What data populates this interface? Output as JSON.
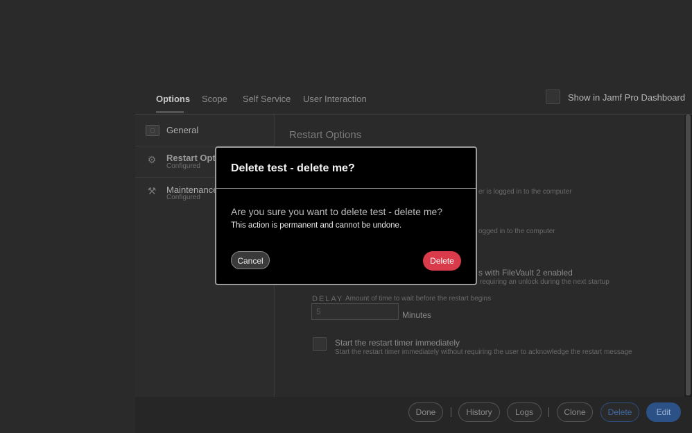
{
  "tabs": [
    {
      "label": "Options"
    },
    {
      "label": "Scope"
    },
    {
      "label": "Self Service"
    },
    {
      "label": "User Interaction"
    }
  ],
  "dashboard": {
    "label": "Show in Jamf Pro Dashboard"
  },
  "sidebar": {
    "items": [
      {
        "label": "General",
        "sub": ""
      },
      {
        "label": "Restart Opti",
        "sub": "Configured"
      },
      {
        "label": "Maintenance",
        "sub": "Configured"
      }
    ]
  },
  "main": {
    "title": "Restart Options",
    "line1": "er is logged in to the computer",
    "line2": "ogged in to the computer",
    "filevault_head": "s with FileVault 2 enabled",
    "filevault_sub": "requiring an unlock during the next startup",
    "delay_label": "DELAY",
    "delay_desc": "Amount of time to wait before the restart begins",
    "delay_value": "5",
    "minutes": "Minutes",
    "timer_head": "Start the restart timer immediately",
    "timer_sub": "Start the restart timer immediately without requiring the user to acknowledge the restart message"
  },
  "footer": {
    "done": "Done",
    "history": "History",
    "logs": "Logs",
    "clone": "Clone",
    "delete": "Delete",
    "edit": "Edit"
  },
  "modal": {
    "title": "Delete test - delete me?",
    "question": "Are you sure you want to delete test - delete me?",
    "note": "This action is permanent and cannot be undone.",
    "cancel": "Cancel",
    "delete": "Delete"
  },
  "colors": {
    "delete_accent": "#d93b4a",
    "edit_accent": "#2b5187"
  },
  "icons": {
    "general": "general-box-icon",
    "restart": "restart-gear-icon",
    "maintenance": "wrench-hammer-icon"
  }
}
